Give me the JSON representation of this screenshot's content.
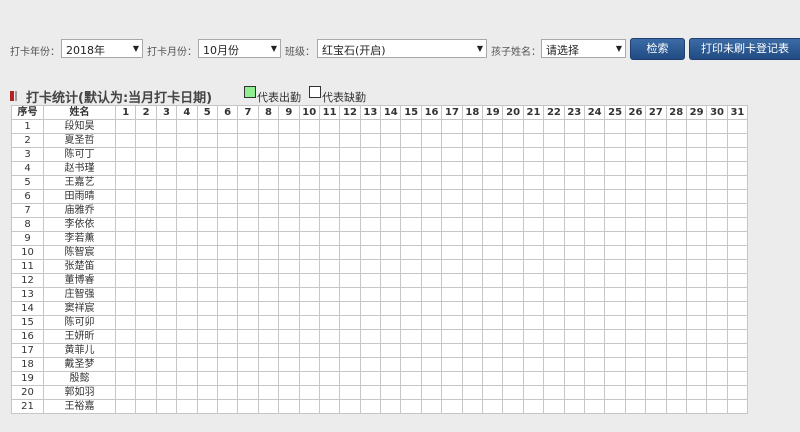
{
  "filters": {
    "year_label": "打卡年份：",
    "year_value": "2018年",
    "month_label": "打卡月份：",
    "month_value": "10月份",
    "class_label": "班级：",
    "class_value": "红宝石(开启)",
    "child_label": "孩子姓名：",
    "child_value": "请选择",
    "search_button": "检索",
    "print_button": "打印未刷卡登记表"
  },
  "section": {
    "title": "打卡统计(默认为:当月打卡日期)",
    "legend_present": "代表出勤",
    "legend_absent": "代表缺勤",
    "legend_present_color": "#90ee90",
    "legend_absent_color": "#ffffff"
  },
  "table": {
    "col_index": "序号",
    "col_name": "姓名",
    "days": [
      "1",
      "2",
      "3",
      "4",
      "5",
      "6",
      "7",
      "8",
      "9",
      "10",
      "11",
      "12",
      "13",
      "14",
      "15",
      "16",
      "17",
      "18",
      "19",
      "20",
      "21",
      "22",
      "23",
      "24",
      "25",
      "26",
      "27",
      "28",
      "29",
      "30",
      "31"
    ],
    "rows": [
      {
        "no": "1",
        "name": "段知昊"
      },
      {
        "no": "2",
        "name": "夏圣哲"
      },
      {
        "no": "3",
        "name": "陈可丁"
      },
      {
        "no": "4",
        "name": "赵书瑾"
      },
      {
        "no": "5",
        "name": "王嘉艺"
      },
      {
        "no": "6",
        "name": "田雨晴"
      },
      {
        "no": "7",
        "name": "庙雅乔"
      },
      {
        "no": "8",
        "name": "李依依"
      },
      {
        "no": "9",
        "name": "李若薰"
      },
      {
        "no": "10",
        "name": "陈智宸"
      },
      {
        "no": "11",
        "name": "张楚笛"
      },
      {
        "no": "12",
        "name": "董博睿"
      },
      {
        "no": "13",
        "name": "庄智强"
      },
      {
        "no": "14",
        "name": "窦祥宸"
      },
      {
        "no": "15",
        "name": "陈可卯"
      },
      {
        "no": "16",
        "name": "王妍昕"
      },
      {
        "no": "17",
        "name": "黄菲儿"
      },
      {
        "no": "18",
        "name": "戴圣梦"
      },
      {
        "no": "19",
        "name": "殷懿"
      },
      {
        "no": "20",
        "name": "郭如羽"
      },
      {
        "no": "21",
        "name": "王裕嘉"
      }
    ]
  }
}
